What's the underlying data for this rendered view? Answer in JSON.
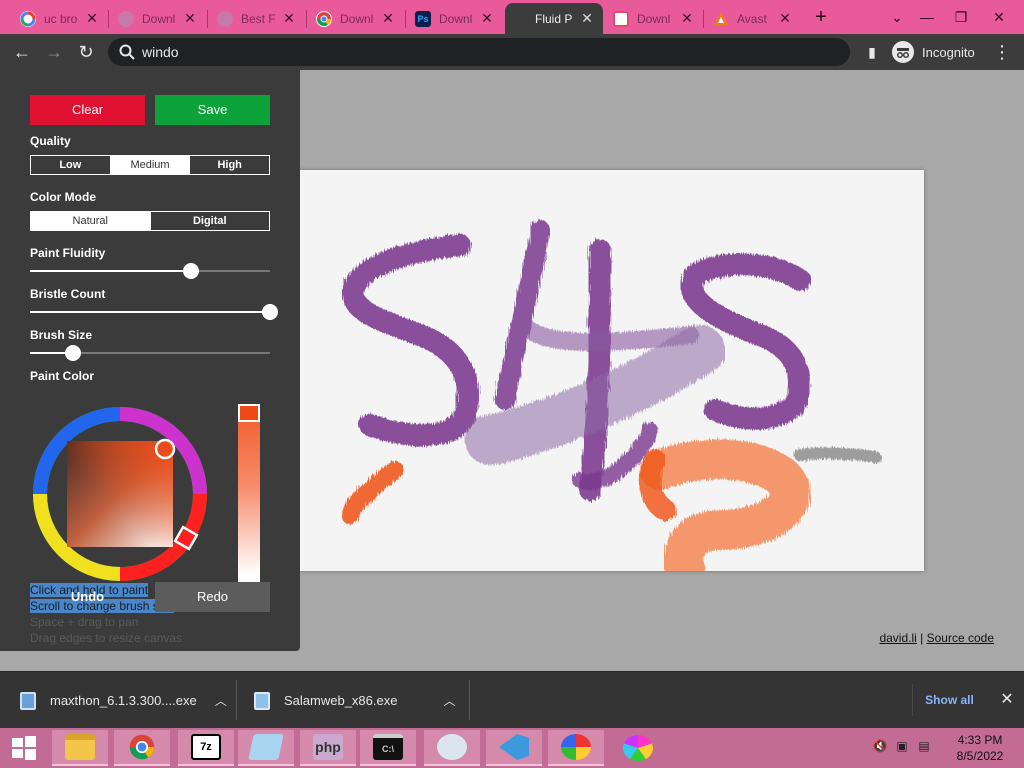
{
  "browser": {
    "tabs": [
      {
        "title": "uc bro",
        "favicon": "google-icon",
        "color": "#ffffff"
      },
      {
        "title": "Downl",
        "favicon": "page-icon",
        "color": "#c77aa9"
      },
      {
        "title": "Best F",
        "favicon": "page-icon",
        "color": "#c77aa9"
      },
      {
        "title": "Downl",
        "favicon": "chrome-icon",
        "color": "#ffffff"
      },
      {
        "title": "Downl",
        "favicon": "ps-icon",
        "color": "#0b1f4f"
      },
      {
        "title": "Fluid P",
        "favicon": "none",
        "color": "#3c3c3c",
        "active": true
      },
      {
        "title": "Downl",
        "favicon": "page-icon",
        "color": "#ffffff"
      },
      {
        "title": "Avast",
        "favicon": "avast-icon",
        "color": "#f07a1a"
      }
    ],
    "address": "windo",
    "incognito_label": "Incognito"
  },
  "panel": {
    "clear_label": "Clear",
    "save_label": "Save",
    "quality": {
      "label": "Quality",
      "options": [
        "Low",
        "Medium",
        "High"
      ],
      "selected": "Medium"
    },
    "color_mode": {
      "label": "Color Mode",
      "options": [
        "Natural",
        "Digital"
      ],
      "selected": "Natural"
    },
    "paint_fluidity": {
      "label": "Paint Fluidity",
      "value": 0.67
    },
    "bristle_count": {
      "label": "Bristle Count",
      "value": 1.0
    },
    "brush_size": {
      "label": "Brush Size",
      "value": 0.18
    },
    "paint_color": {
      "label": "Paint Color",
      "color": "#f04a14"
    },
    "undo_label": "Undo",
    "redo_label": "Redo",
    "hints": [
      "Click and hold to paint",
      "Scroll to change brush size",
      "Space + drag to pan",
      "Drag edges to resize canvas"
    ]
  },
  "credits": {
    "author": "david.li",
    "separator": "|",
    "source": "Source code"
  },
  "downloads": {
    "items": [
      {
        "name": "maxthon_6.1.3.300....exe"
      },
      {
        "name": "Salamweb_x86.exe"
      }
    ],
    "show_all_label": "Show all"
  },
  "taskbar": {
    "apps": [
      "file-explorer-icon",
      "chrome-icon",
      "7zip-icon",
      "notepad-icon",
      "php-icon",
      "cmd-icon",
      "media-player-icon",
      "vscode-icon",
      "photos-icon",
      "paint-icon"
    ],
    "time": "4:33 PM",
    "date": "8/5/2022"
  }
}
